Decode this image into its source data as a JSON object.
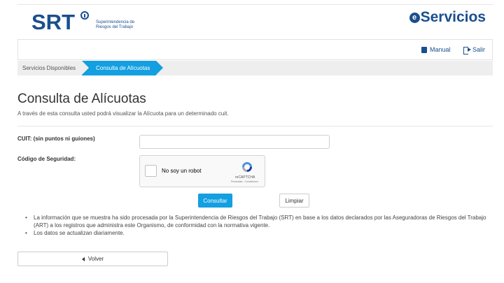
{
  "header": {
    "logo_text": "SRT",
    "logo_subtitle_line1": "Superintendencia de",
    "logo_subtitle_line2": "Riesgos del Trabajo",
    "eservicios_letter": "e",
    "eservicios_rest": "Servicios"
  },
  "nav": {
    "manual_label": "Manual",
    "salir_label": "Salir"
  },
  "breadcrumb": {
    "items": [
      "Servicios Disponibles",
      "Consulta de Alícuotas"
    ]
  },
  "page": {
    "title": "Consulta de Alícuotas",
    "description": "A través de esta consulta usted podrá visualizar la Alícuota para un determinado cuit."
  },
  "form": {
    "cuit_label": "CUIT: (sin puntos ni guiones)",
    "cuit_value": "",
    "code_label": "Código de Seguridad:",
    "recaptcha_text": "No soy un robot",
    "recaptcha_brand": "reCAPTCHA",
    "recaptcha_terms": "Privacidad - Condiciones",
    "submit_label": "Consultar",
    "clear_label": "Limpiar"
  },
  "notes": [
    "La información que se muestra ha sido procesada por la Superintendencia de Riesgos del Trabajo (SRT) en base a los datos declarados por las Aseguradoras de Riesgos del Trabajo (ART) a los registros que administra este Organismo, de conformidad con la normativa vigente.",
    "Los datos se actualizan diariamente."
  ],
  "back_label": "Volver",
  "colors": {
    "brand_blue": "#1a4f8e",
    "accent_blue": "#139fe0"
  }
}
